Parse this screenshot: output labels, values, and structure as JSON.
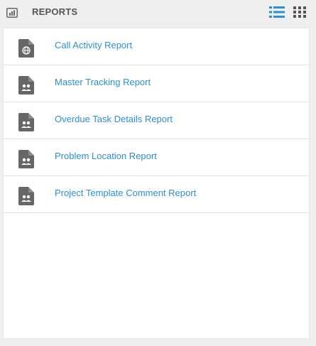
{
  "header": {
    "title": "REPORTS",
    "icon": "bar-chart-icon",
    "views": [
      {
        "name": "list-view",
        "icon": "list-icon",
        "active": true,
        "color": "#2a8fd4"
      },
      {
        "name": "grid-view",
        "icon": "grid-icon",
        "active": false,
        "color": "#555555"
      }
    ]
  },
  "reports": [
    {
      "label": "Call Activity Report",
      "icon": "globe-document-icon"
    },
    {
      "label": "Master Tracking Report",
      "icon": "people-document-icon"
    },
    {
      "label": "Overdue Task Details Report",
      "icon": "people-document-icon"
    },
    {
      "label": "Problem Location Report",
      "icon": "people-document-icon"
    },
    {
      "label": "Project Template Comment Report",
      "icon": "people-document-icon"
    }
  ],
  "colors": {
    "link": "#2a8fd4",
    "icon": "#666666",
    "background": "#efefef"
  }
}
